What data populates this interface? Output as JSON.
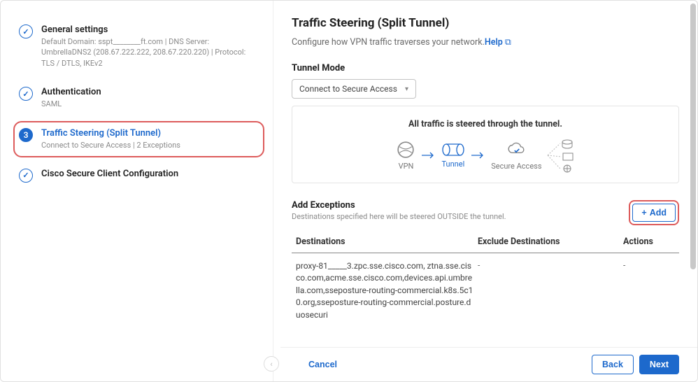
{
  "sidebar": {
    "steps": [
      {
        "title": "General settings",
        "sub": "Default Domain: sspt________ft.com | DNS Server: UmbrellaDNS2 (208.67.222.222, 208.67.220.220) | Protocol: TLS / DTLS, IKEv2"
      },
      {
        "title": "Authentication",
        "sub": "SAML"
      },
      {
        "title": "Traffic Steering (Split Tunnel)",
        "sub": "Connect to Secure Access | 2 Exceptions",
        "num": "3"
      },
      {
        "title": "Cisco Secure Client Configuration",
        "sub": ""
      }
    ]
  },
  "main": {
    "heading": "Traffic Steering (Split Tunnel)",
    "intro": "Configure how VPN traffic traverses your network.",
    "helpLabel": "Help",
    "tunnelModeLabel": "Tunnel Mode",
    "tunnelModeValue": "Connect to Secure Access",
    "diagramTitle": "All traffic is steered through the tunnel.",
    "diagramLabels": {
      "vpn": "VPN",
      "tunnel": "Tunnel",
      "secure": "Secure Access"
    },
    "exceptions": {
      "title": "Add Exceptions",
      "hint": "Destinations specified here will be steered OUTSIDE the tunnel.",
      "addLabel": "Add"
    },
    "table": {
      "headers": {
        "dest": "Destinations",
        "excl": "Exclude Destinations",
        "act": "Actions"
      },
      "rows": [
        {
          "dest": "proxy-81_____3.zpc.sse.cisco.com, ztna.sse.cisco.com,acme.sse.cisco.com,devices.api.umbrella.com,sseposture-routing-commercial.k8s.5c10.org,sseposture-routing-commercial.posture.duosecuri",
          "excl": "-",
          "act": "-"
        }
      ]
    }
  },
  "footer": {
    "cancel": "Cancel",
    "back": "Back",
    "next": "Next"
  }
}
